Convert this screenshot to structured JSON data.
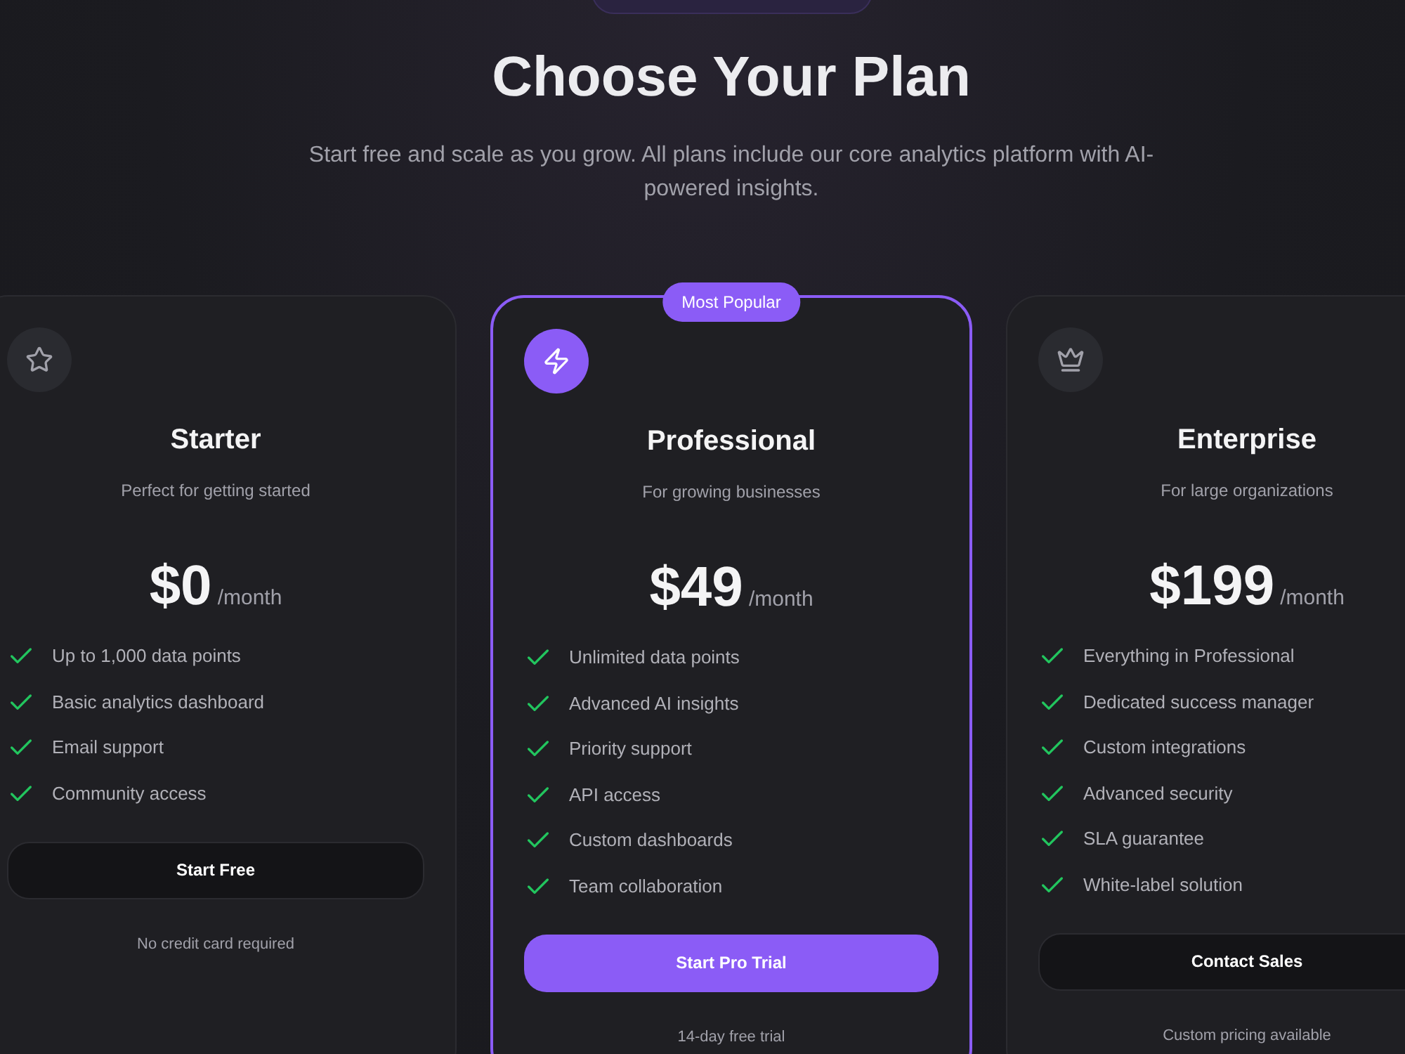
{
  "header": {
    "title": "Choose Your Plan",
    "subtitle": "Start free and scale as you grow. All plans include our core analytics platform with AI-powered insights."
  },
  "plans": [
    {
      "name": "Starter",
      "description": "Perfect for getting started",
      "price": "$0",
      "period": "/month",
      "featured": false,
      "features": [
        "Up to 1,000 data points",
        "Basic analytics dashboard",
        "Email support",
        "Community access"
      ],
      "button": "Start Free",
      "note": "No credit card required"
    },
    {
      "name": "Professional",
      "badge": "Most Popular",
      "description": "For growing businesses",
      "price": "$49",
      "period": "/month",
      "featured": true,
      "features": [
        "Unlimited data points",
        "Advanced AI insights",
        "Priority support",
        "API access",
        "Custom dashboards",
        "Team collaboration"
      ],
      "button": "Start Pro Trial",
      "note": "14-day free trial"
    },
    {
      "name": "Enterprise",
      "description": "For large organizations",
      "price": "$199",
      "period": "/month",
      "featured": false,
      "features": [
        "Everything in Professional",
        "Dedicated success manager",
        "Custom integrations",
        "Advanced security",
        "SLA guarantee",
        "White-label solution"
      ],
      "button": "Contact Sales",
      "note": "Custom pricing available"
    }
  ]
}
